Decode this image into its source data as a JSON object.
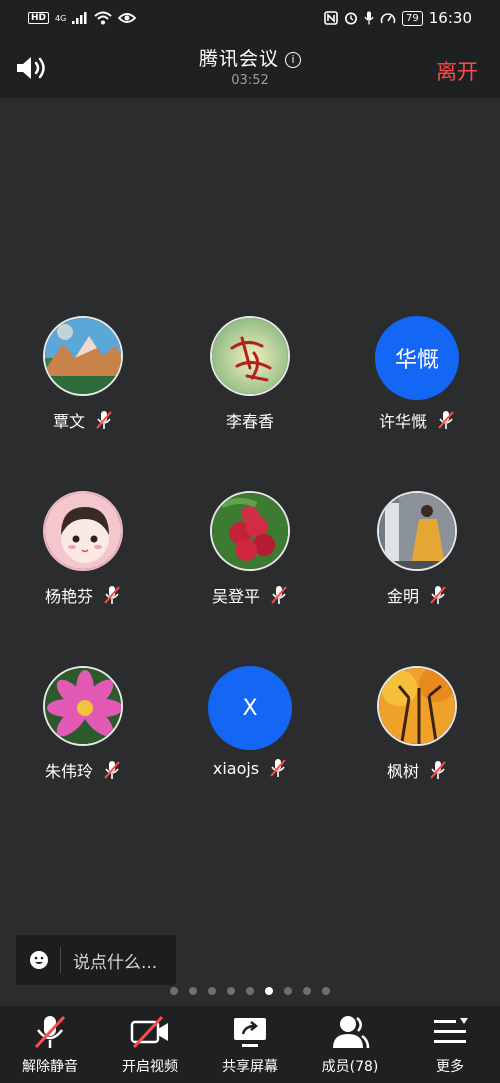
{
  "status_bar": {
    "hd": "HD",
    "network": "4G",
    "battery": "79",
    "time": "16:30"
  },
  "header": {
    "title": "腾讯会议",
    "timer": "03:52",
    "leave_label": "离开"
  },
  "participants": [
    {
      "name": "覃文",
      "muted": true,
      "avatar": "landscape-photo"
    },
    {
      "name": "李春香",
      "muted": false,
      "avatar": "calligraphy-photo"
    },
    {
      "name": "许华慨",
      "muted": true,
      "avatar_text": "华慨"
    },
    {
      "name": "杨艳芬",
      "muted": true,
      "avatar": "cartoon-girl"
    },
    {
      "name": "吴登平",
      "muted": true,
      "avatar": "lychee-photo"
    },
    {
      "name": "金明",
      "muted": true,
      "avatar": "woman-yellow-dress"
    },
    {
      "name": "朱伟玲",
      "muted": true,
      "avatar": "lotus-flower"
    },
    {
      "name": "xiaojs",
      "muted": true,
      "avatar_text": "X"
    },
    {
      "name": "枫树",
      "muted": true,
      "avatar": "autumn-trees"
    }
  ],
  "chat": {
    "placeholder": "说点什么..."
  },
  "pager": {
    "count": 9,
    "active": 5
  },
  "toolbar": {
    "unmute": "解除静音",
    "video": "开启视频",
    "share": "共享屏幕",
    "members": "成员(78)",
    "more": "更多"
  },
  "colors": {
    "background": "#2b2c2e",
    "bar": "#1f2022",
    "leave": "#ff4b4b",
    "avatar_blue": "#1466f5",
    "mute_red": "#ff4b4b"
  }
}
